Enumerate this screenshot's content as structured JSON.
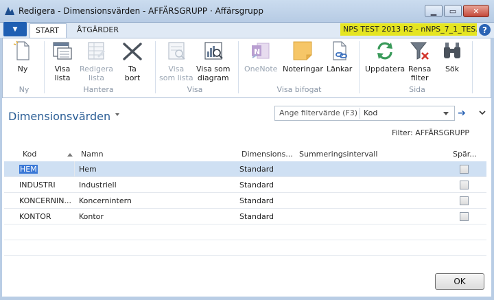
{
  "window": {
    "title": "Redigera - Dimensionsvärden - AFFÄRSGRUPP · Affärsgrupp",
    "minimize": "▁",
    "maximize": "▭",
    "close": "✕"
  },
  "ribbon_tabs": [
    {
      "label": "START"
    },
    {
      "label": "ÅTGÄRDER"
    }
  ],
  "company_label": "NPS TEST 2013 R2 - nNPS_7_1_TES...",
  "help_label": "?",
  "ribbon": {
    "new": {
      "label1": "Ny",
      "label2": ""
    },
    "groups": {
      "new": "Ny",
      "manage": "Hantera",
      "view": "Visa",
      "attached": "Visa bifogat",
      "page": "Sida"
    },
    "buttons": {
      "show_list": {
        "l1": "Visa",
        "l2": "lista"
      },
      "edit_list": {
        "l1": "Redigera",
        "l2": "lista"
      },
      "delete": {
        "l1": "Ta",
        "l2": "bort"
      },
      "show_as_list": {
        "l1": "Visa",
        "l2": "som lista"
      },
      "show_as_chart": {
        "l1": "Visa som",
        "l2": "diagram"
      },
      "onenote": {
        "l1": "OneNote",
        "l2": ""
      },
      "notes": {
        "l1": "Noteringar",
        "l2": ""
      },
      "links": {
        "l1": "Länkar",
        "l2": ""
      },
      "refresh": {
        "l1": "Uppdatera",
        "l2": ""
      },
      "clear_filter": {
        "l1": "Rensa",
        "l2": "filter"
      },
      "find": {
        "l1": "Sök",
        "l2": ""
      }
    }
  },
  "page": {
    "title": "Dimensionsvärden",
    "filter_placeholder": "Ange filtervärde (F3)",
    "filter_field": "Kod",
    "filter_label": "Filter: AFFÄRSGRUPP"
  },
  "table": {
    "headers": {
      "kod": "Kod",
      "namn": "Namn",
      "type": "Dimensions...",
      "totaling": "Summeringsintervall",
      "blocked": "Spär..."
    },
    "rows": [
      {
        "kod": "HEM",
        "namn": "Hem",
        "type": "Standard"
      },
      {
        "kod": "INDUSTRI",
        "namn": "Industriell",
        "type": "Standard"
      },
      {
        "kod": "KONCERNIN...",
        "namn": "Koncernintern",
        "type": "Standard"
      },
      {
        "kod": "KONTOR",
        "namn": "Kontor",
        "type": "Standard"
      }
    ]
  },
  "ok_button": "OK",
  "colors": {
    "accent": "#2a5d95",
    "company_highlight": "#e5e522",
    "selection": "#cfe0f3"
  }
}
